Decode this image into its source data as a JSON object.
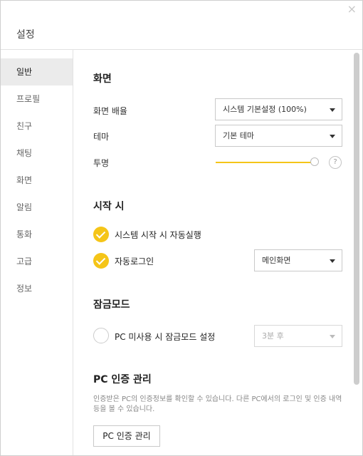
{
  "window": {
    "title": "설정",
    "close_symbol": "×"
  },
  "sidebar": {
    "items": [
      {
        "label": "일반",
        "active": true
      },
      {
        "label": "프로필"
      },
      {
        "label": "친구"
      },
      {
        "label": "채팅"
      },
      {
        "label": "화면"
      },
      {
        "label": "알림"
      },
      {
        "label": "통화"
      },
      {
        "label": "고급"
      },
      {
        "label": "정보"
      }
    ]
  },
  "screen": {
    "title": "화면",
    "zoom_label": "화면 배율",
    "zoom_value": "시스템 기본설정 (100%)",
    "theme_label": "테마",
    "theme_value": "기본 테마",
    "opacity_label": "투명",
    "opacity_value": 1.0,
    "help_symbol": "?"
  },
  "startup": {
    "title": "시작 시",
    "auto_login_label": "시스템 시작 시 자동실행",
    "auto_login_checked": true,
    "window_label": "자동로그인",
    "window_checked": true,
    "window_value": "메인화면"
  },
  "auto_lock": {
    "title": "잠금모드",
    "label": "PC 미사용 시 잠금모드 설정",
    "checked": false,
    "value": "3분 후"
  },
  "pc_auth": {
    "title": "PC 인증 관리",
    "description": "인증받은 PC의 인증정보를 확인할 수 있습니다. 다른 PC에서의 로그인 및 인증 내역 등을 볼 수 있습니다.",
    "button_label": "PC 인증 관리"
  },
  "colors": {
    "accent": "#f5c518",
    "sidebar_active": "#ebebeb"
  }
}
